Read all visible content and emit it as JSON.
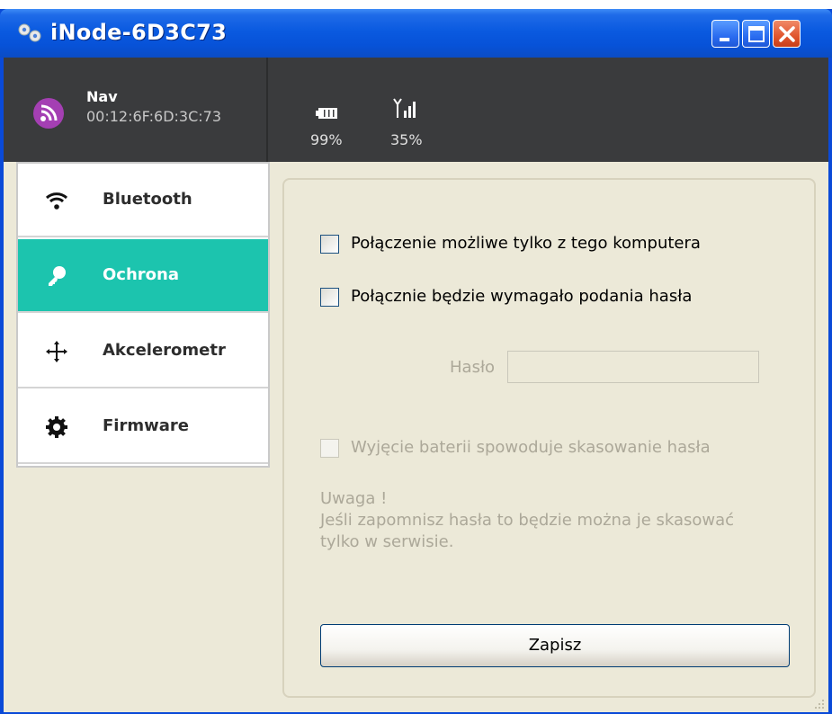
{
  "window": {
    "title": "iNode-6D3C73",
    "buttons": [
      "minimize",
      "maximize",
      "close"
    ]
  },
  "device": {
    "name": "Nav",
    "mac": "00:12:6F:6D:3C:73",
    "icon": "rss-feed-icon",
    "battery": "99%",
    "signal": "35%"
  },
  "sidebar": {
    "items": [
      {
        "label": "Bluetooth",
        "icon": "wifi-icon",
        "active": false
      },
      {
        "label": "Ochrona",
        "icon": "key-icon",
        "active": true
      },
      {
        "label": "Akcelerometr",
        "icon": "move-arrows-icon",
        "active": false
      },
      {
        "label": "Firmware",
        "icon": "gear-icon",
        "active": false
      }
    ]
  },
  "content": {
    "option1": "Połączenie możliwe tylko z tego komputera",
    "option2": "Połącznie będzie wymagało podania hasła",
    "password_label": "Hasło",
    "password_value": "",
    "option3": "Wyjęcie baterii spowoduje skasowanie hasła",
    "note_title": "Uwaga !",
    "note_line1": "Jeśli zapomnisz hasła to będzie można je skasować",
    "note_line2": "tylko w serwisie.",
    "save_label": "Zapisz"
  },
  "colors": {
    "accent": "#1cc4ae",
    "header": "#3a3b3d",
    "title_bar": "#0752d8",
    "device_badge": "#a43fb3"
  }
}
